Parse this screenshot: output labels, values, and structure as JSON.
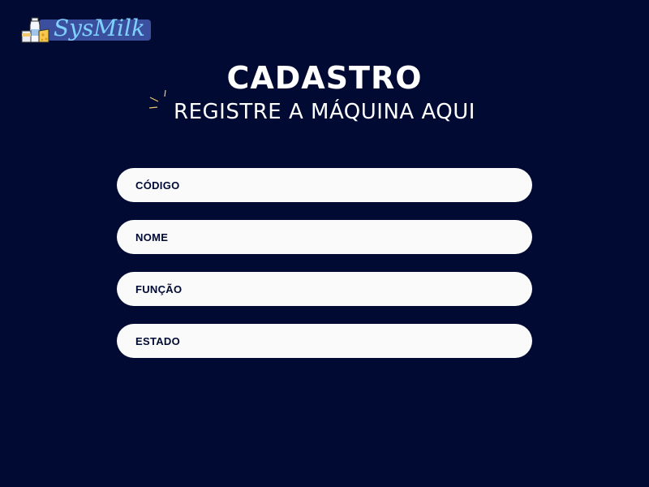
{
  "app": {
    "logo_text": "SysMilk"
  },
  "header": {
    "title": "CADASTRO",
    "subtitle": "REGISTRE A MÁQUINA AQUI"
  },
  "form": {
    "fields": [
      {
        "label": "CÓDIGO"
      },
      {
        "label": "NOME"
      },
      {
        "label": "FUNÇÃO"
      },
      {
        "label": "ESTADO"
      }
    ]
  },
  "colors": {
    "background": "#000a33",
    "field_background": "#fafafa",
    "field_text": "#000a33",
    "logo_bar": "#3a4f9e",
    "logo_text": "#7fd2ff"
  }
}
